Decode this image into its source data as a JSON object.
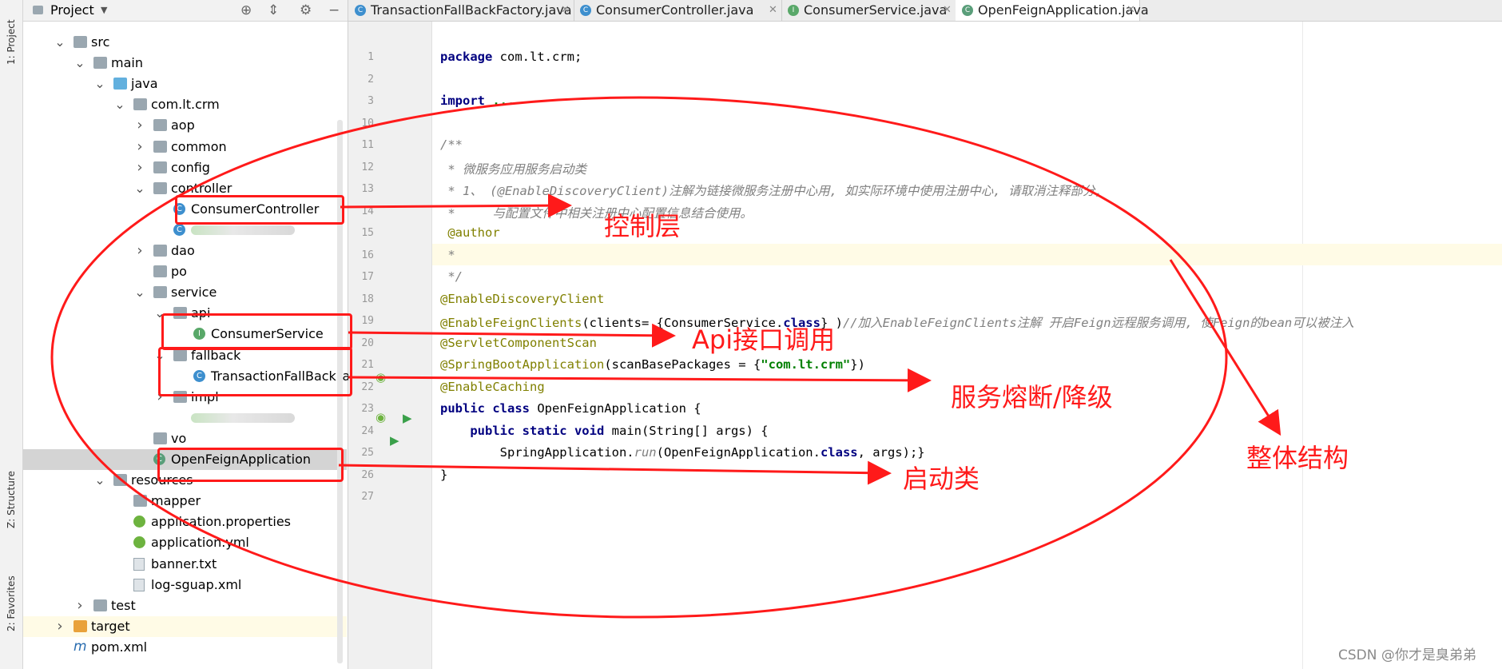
{
  "strip": {
    "project_tab": "1: Project",
    "structure_tab": "Z: Structure",
    "favorites_tab": "2: Favorites"
  },
  "project_panel": {
    "title": "Project",
    "tree": [
      {
        "label": "src",
        "depth": 2,
        "icon": "folder",
        "chevron": "down"
      },
      {
        "label": "main",
        "depth": 3,
        "icon": "folder",
        "chevron": "down"
      },
      {
        "label": "java",
        "depth": 4,
        "icon": "folder-blue",
        "chevron": "down"
      },
      {
        "label": "com.lt.crm",
        "depth": 5,
        "icon": "folder",
        "chevron": "down"
      },
      {
        "label": "aop",
        "depth": 6,
        "icon": "folder",
        "chevron": "right"
      },
      {
        "label": "common",
        "depth": 6,
        "icon": "folder",
        "chevron": "right"
      },
      {
        "label": "config",
        "depth": 6,
        "icon": "folder",
        "chevron": "right"
      },
      {
        "label": "controller",
        "depth": 6,
        "icon": "folder",
        "chevron": "down"
      },
      {
        "label": "ConsumerController",
        "depth": 7,
        "icon": "class",
        "chevron": ""
      },
      {
        "label": "",
        "depth": 7,
        "icon": "class",
        "chevron": "",
        "blurred": true
      },
      {
        "label": "dao",
        "depth": 6,
        "icon": "folder",
        "chevron": "right"
      },
      {
        "label": "po",
        "depth": 6,
        "icon": "folder",
        "chevron": ""
      },
      {
        "label": "service",
        "depth": 6,
        "icon": "folder",
        "chevron": "down"
      },
      {
        "label": "api",
        "depth": 7,
        "icon": "folder",
        "chevron": "down"
      },
      {
        "label": "ConsumerService",
        "depth": 8,
        "icon": "interface",
        "chevron": ""
      },
      {
        "label": "fallback",
        "depth": 7,
        "icon": "folder",
        "chevron": "down"
      },
      {
        "label": "TransactionFallBackFa",
        "depth": 8,
        "icon": "class",
        "chevron": ""
      },
      {
        "label": "impl",
        "depth": 7,
        "icon": "folder",
        "chevron": "right"
      },
      {
        "label": "",
        "depth": 7,
        "icon": "none",
        "chevron": "",
        "blurred": true
      },
      {
        "label": "vo",
        "depth": 6,
        "icon": "folder",
        "chevron": ""
      },
      {
        "label": "OpenFeignApplication",
        "depth": 6,
        "icon": "spring-class",
        "chevron": "",
        "selected": true
      },
      {
        "label": "resources",
        "depth": 4,
        "icon": "folder",
        "chevron": "down"
      },
      {
        "label": "mapper",
        "depth": 5,
        "icon": "folder",
        "chevron": ""
      },
      {
        "label": "application.properties",
        "depth": 5,
        "icon": "leaf",
        "chevron": ""
      },
      {
        "label": "application.yml",
        "depth": 5,
        "icon": "leaf",
        "chevron": ""
      },
      {
        "label": "banner.txt",
        "depth": 5,
        "icon": "file",
        "chevron": ""
      },
      {
        "label": "log-sguap.xml",
        "depth": 5,
        "icon": "file",
        "chevron": ""
      },
      {
        "label": "test",
        "depth": 3,
        "icon": "folder",
        "chevron": "right"
      },
      {
        "label": "target",
        "depth": 2,
        "icon": "folder-orange",
        "chevron": "right",
        "highlight": true
      },
      {
        "label": "pom.xml",
        "depth": 2,
        "icon": "maven",
        "chevron": ""
      }
    ]
  },
  "tabs": [
    {
      "label": "TransactionFallBackFactory.java",
      "icon": "class"
    },
    {
      "label": "ConsumerController.java",
      "icon": "class"
    },
    {
      "label": "ConsumerService.java",
      "icon": "interface"
    },
    {
      "label": "OpenFeignApplication.java",
      "icon": "spring-class",
      "active": true
    }
  ],
  "editor": {
    "lines": [
      {
        "n": "1",
        "parts": [
          {
            "t": "kw",
            "v": "package"
          },
          {
            "t": "",
            "v": " com.lt.crm;"
          }
        ]
      },
      {
        "n": "2",
        "parts": []
      },
      {
        "n": "3",
        "parts": [
          {
            "t": "kw",
            "v": "import"
          },
          {
            "t": "",
            "v": " "
          },
          {
            "t": "st",
            "v": "..."
          }
        ]
      },
      {
        "n": "10",
        "parts": []
      },
      {
        "n": "11",
        "parts": [
          {
            "t": "cm",
            "v": "/**"
          }
        ]
      },
      {
        "n": "12",
        "parts": [
          {
            "t": "cm",
            "v": " * 微服务应用服务启动类"
          }
        ]
      },
      {
        "n": "13",
        "parts": [
          {
            "t": "cm",
            "v": " * 1、 (@EnableDiscoveryClient)注解为链接微服务注册中心用, 如实际环境中使用注册中心, 请取消注释部分,"
          }
        ]
      },
      {
        "n": "14",
        "parts": [
          {
            "t": "cm",
            "v": " *     与配置文件中相关注册中心配置信息结合使用。"
          }
        ]
      },
      {
        "n": "15",
        "parts": [
          {
            "t": "cm",
            "v": " "
          },
          {
            "t": "an",
            "v": "@author"
          }
        ]
      },
      {
        "n": "16",
        "parts": [
          {
            "t": "cm",
            "v": " *"
          }
        ]
      },
      {
        "n": "17",
        "parts": [
          {
            "t": "cm",
            "v": " */"
          }
        ]
      },
      {
        "n": "18",
        "parts": [
          {
            "t": "an",
            "v": "@EnableDiscoveryClient"
          }
        ]
      },
      {
        "n": "19",
        "parts": [
          {
            "t": "an",
            "v": "@EnableFeignClients"
          },
          {
            "t": "",
            "v": "(clients= {ConsumerService."
          },
          {
            "t": "kw",
            "v": "class"
          },
          {
            "t": "",
            "v": "} )"
          },
          {
            "t": "cm",
            "v": "//加入EnableFeignClients注解 开启Feign远程服务调用, 使Feign的bean可以被注入"
          }
        ]
      },
      {
        "n": "20",
        "parts": [
          {
            "t": "an",
            "v": "@ServletComponentScan"
          }
        ]
      },
      {
        "n": "21",
        "parts": [
          {
            "t": "an",
            "v": "@SpringBootApplication"
          },
          {
            "t": "",
            "v": "(scanBasePackages = {"
          },
          {
            "t": "st",
            "v": "\"com.lt.crm\""
          },
          {
            "t": "",
            "v": "})"
          }
        ]
      },
      {
        "n": "22",
        "parts": [
          {
            "t": "an",
            "v": "@EnableCaching"
          }
        ]
      },
      {
        "n": "23",
        "parts": [
          {
            "t": "kw",
            "v": "public class"
          },
          {
            "t": "",
            "v": " OpenFeignApplication {"
          }
        ]
      },
      {
        "n": "24",
        "parts": [
          {
            "t": "",
            "v": "    "
          },
          {
            "t": "kw",
            "v": "public static void"
          },
          {
            "t": "",
            "v": " main(String[] args) {"
          }
        ]
      },
      {
        "n": "25",
        "parts": [
          {
            "t": "",
            "v": "        SpringApplication."
          },
          {
            "t": "cm",
            "v": "run"
          },
          {
            "t": "",
            "v": "(OpenFeignApplication."
          },
          {
            "t": "kw",
            "v": "class"
          },
          {
            "t": "",
            "v": ", args);}"
          }
        ]
      },
      {
        "n": "26",
        "parts": [
          {
            "t": "",
            "v": "}"
          }
        ]
      },
      {
        "n": "27",
        "parts": []
      }
    ]
  },
  "annotations": {
    "controller": "控制层",
    "api": "Api接口调用",
    "fallback": "服务熔断/降级",
    "startup": "启动类",
    "overall": "整体结构",
    "watermark": "CSDN @你才是臭弟弟"
  },
  "colors": {
    "annotation_red": "#ff1a1a",
    "selection": "#d4d4d4",
    "current_line": "#fffbe6"
  }
}
